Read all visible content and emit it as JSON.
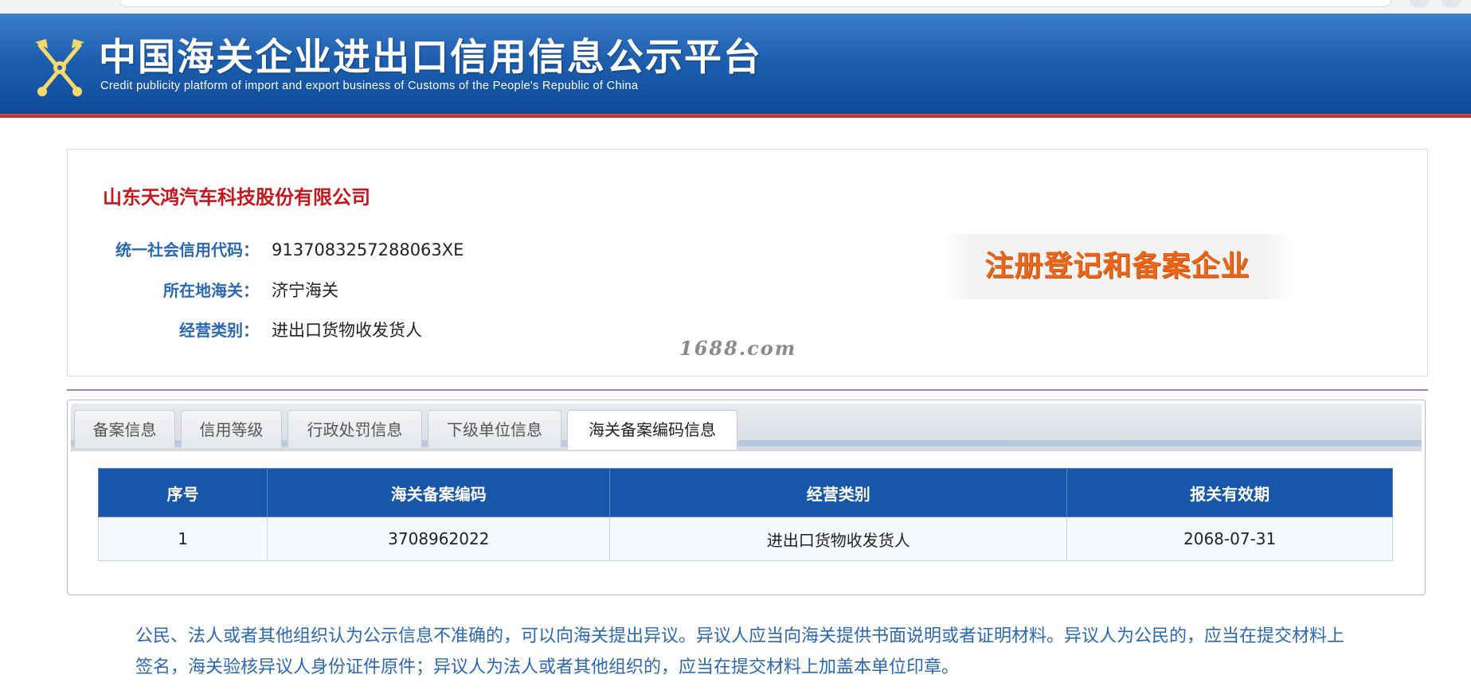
{
  "header": {
    "title": "中国海关企业进出口信用信息公示平台",
    "subtitle": "Credit publicity platform of import and export business of Customs of the People's Republic of China"
  },
  "company": {
    "name": "山东天鸿汽车科技股份有限公司",
    "fields": [
      {
        "label": "统一社会信用代码：",
        "value": "9137083257288063XE"
      },
      {
        "label": "所在地海关：",
        "value": "济宁海关"
      },
      {
        "label": "经营类别：",
        "value": "进出口货物收发货人"
      }
    ],
    "badge": "注册登记和备案企业"
  },
  "watermark": "1688.com",
  "tabs": [
    {
      "label": "备案信息",
      "active": false
    },
    {
      "label": "信用等级",
      "active": false
    },
    {
      "label": "行政处罚信息",
      "active": false
    },
    {
      "label": "下级单位信息",
      "active": false
    },
    {
      "label": "海关备案编码信息",
      "active": true
    }
  ],
  "table": {
    "headers": [
      "序号",
      "海关备案编码",
      "经营类别",
      "报关有效期"
    ],
    "rows": [
      [
        "1",
        "3708962022",
        "进出口货物收发货人",
        "2068-07-31"
      ]
    ]
  },
  "notice": "公民、法人或者其他组织认为公示信息不准确的，可以向海关提出异议。异议人应当向海关提供书面说明或者证明材料。异议人为公民的，应当在提交材料上签名，海关验核异议人身份证件原件；异议人为法人或者其他组织的，应当在提交材料上加盖本单位印章。",
  "colors": {
    "banner": "#1e5fb0",
    "accent_red": "#c8161d",
    "label_blue": "#2b68b3",
    "table_header": "#1756a8",
    "badge_orange": "#e8661a"
  },
  "icons": {
    "emblem": "customs-emblem-icon"
  }
}
